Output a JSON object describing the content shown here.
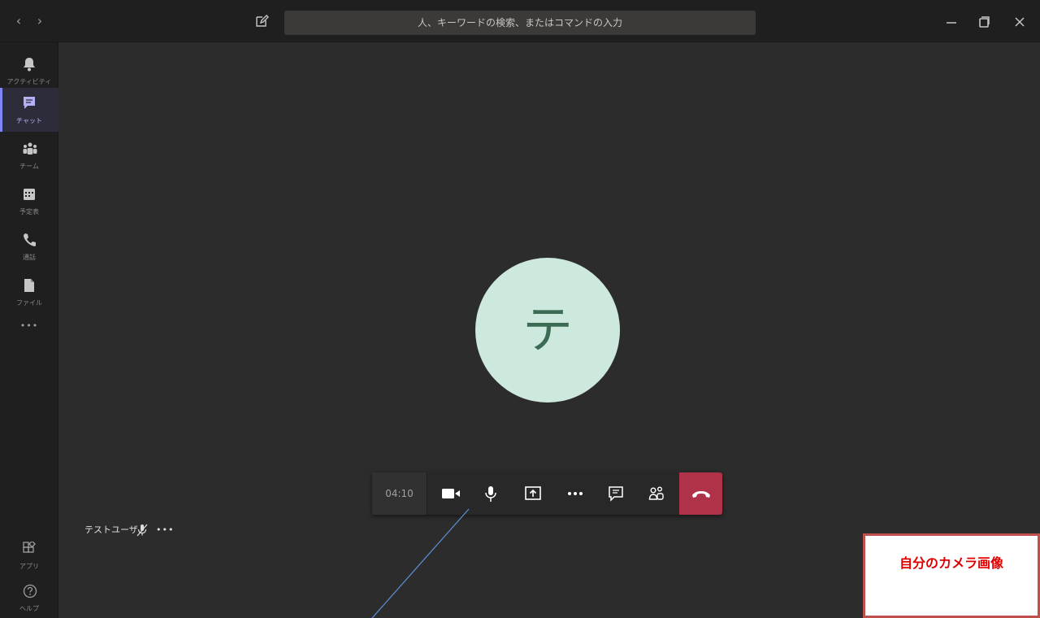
{
  "titlebar": {
    "back_glyph": "‹",
    "forward_glyph": "›",
    "search_placeholder": "人、キーワードの検索、またはコマンドの入力",
    "icons": [
      "back-icon",
      "forward-icon",
      "compose-icon",
      "minimize-icon",
      "restore-icon",
      "close-icon"
    ]
  },
  "rail": {
    "items": [
      {
        "label": "アクティビティ",
        "icon": "bell-icon",
        "active": false
      },
      {
        "label": "チャット",
        "icon": "chat-icon",
        "active": true
      },
      {
        "label": "チーム",
        "icon": "teams-icon",
        "active": false
      },
      {
        "label": "予定表",
        "icon": "calendar-icon",
        "active": false
      },
      {
        "label": "通話",
        "icon": "phone-icon",
        "active": false
      },
      {
        "label": "ファイル",
        "icon": "file-icon",
        "active": false
      }
    ],
    "more_glyph": "•••",
    "apps_label": "アプリ",
    "help_label": "ヘルプ"
  },
  "stage": {
    "avatar_initial": "テ",
    "avatar_color": "#cde8dc"
  },
  "callbar": {
    "timer": "04:10",
    "buttons": [
      "video-icon",
      "microphone-icon",
      "share-screen-icon",
      "more-options-icon",
      "chat-icon",
      "participants-icon",
      "hang-up-icon"
    ],
    "hangup_color": "#b03248"
  },
  "participant": {
    "name": "テストユーザ",
    "more_glyph": "•••"
  },
  "annotation": {
    "label": "自分のカメラ画像",
    "border_color": "#c0504d",
    "text_color": "#e00000"
  }
}
